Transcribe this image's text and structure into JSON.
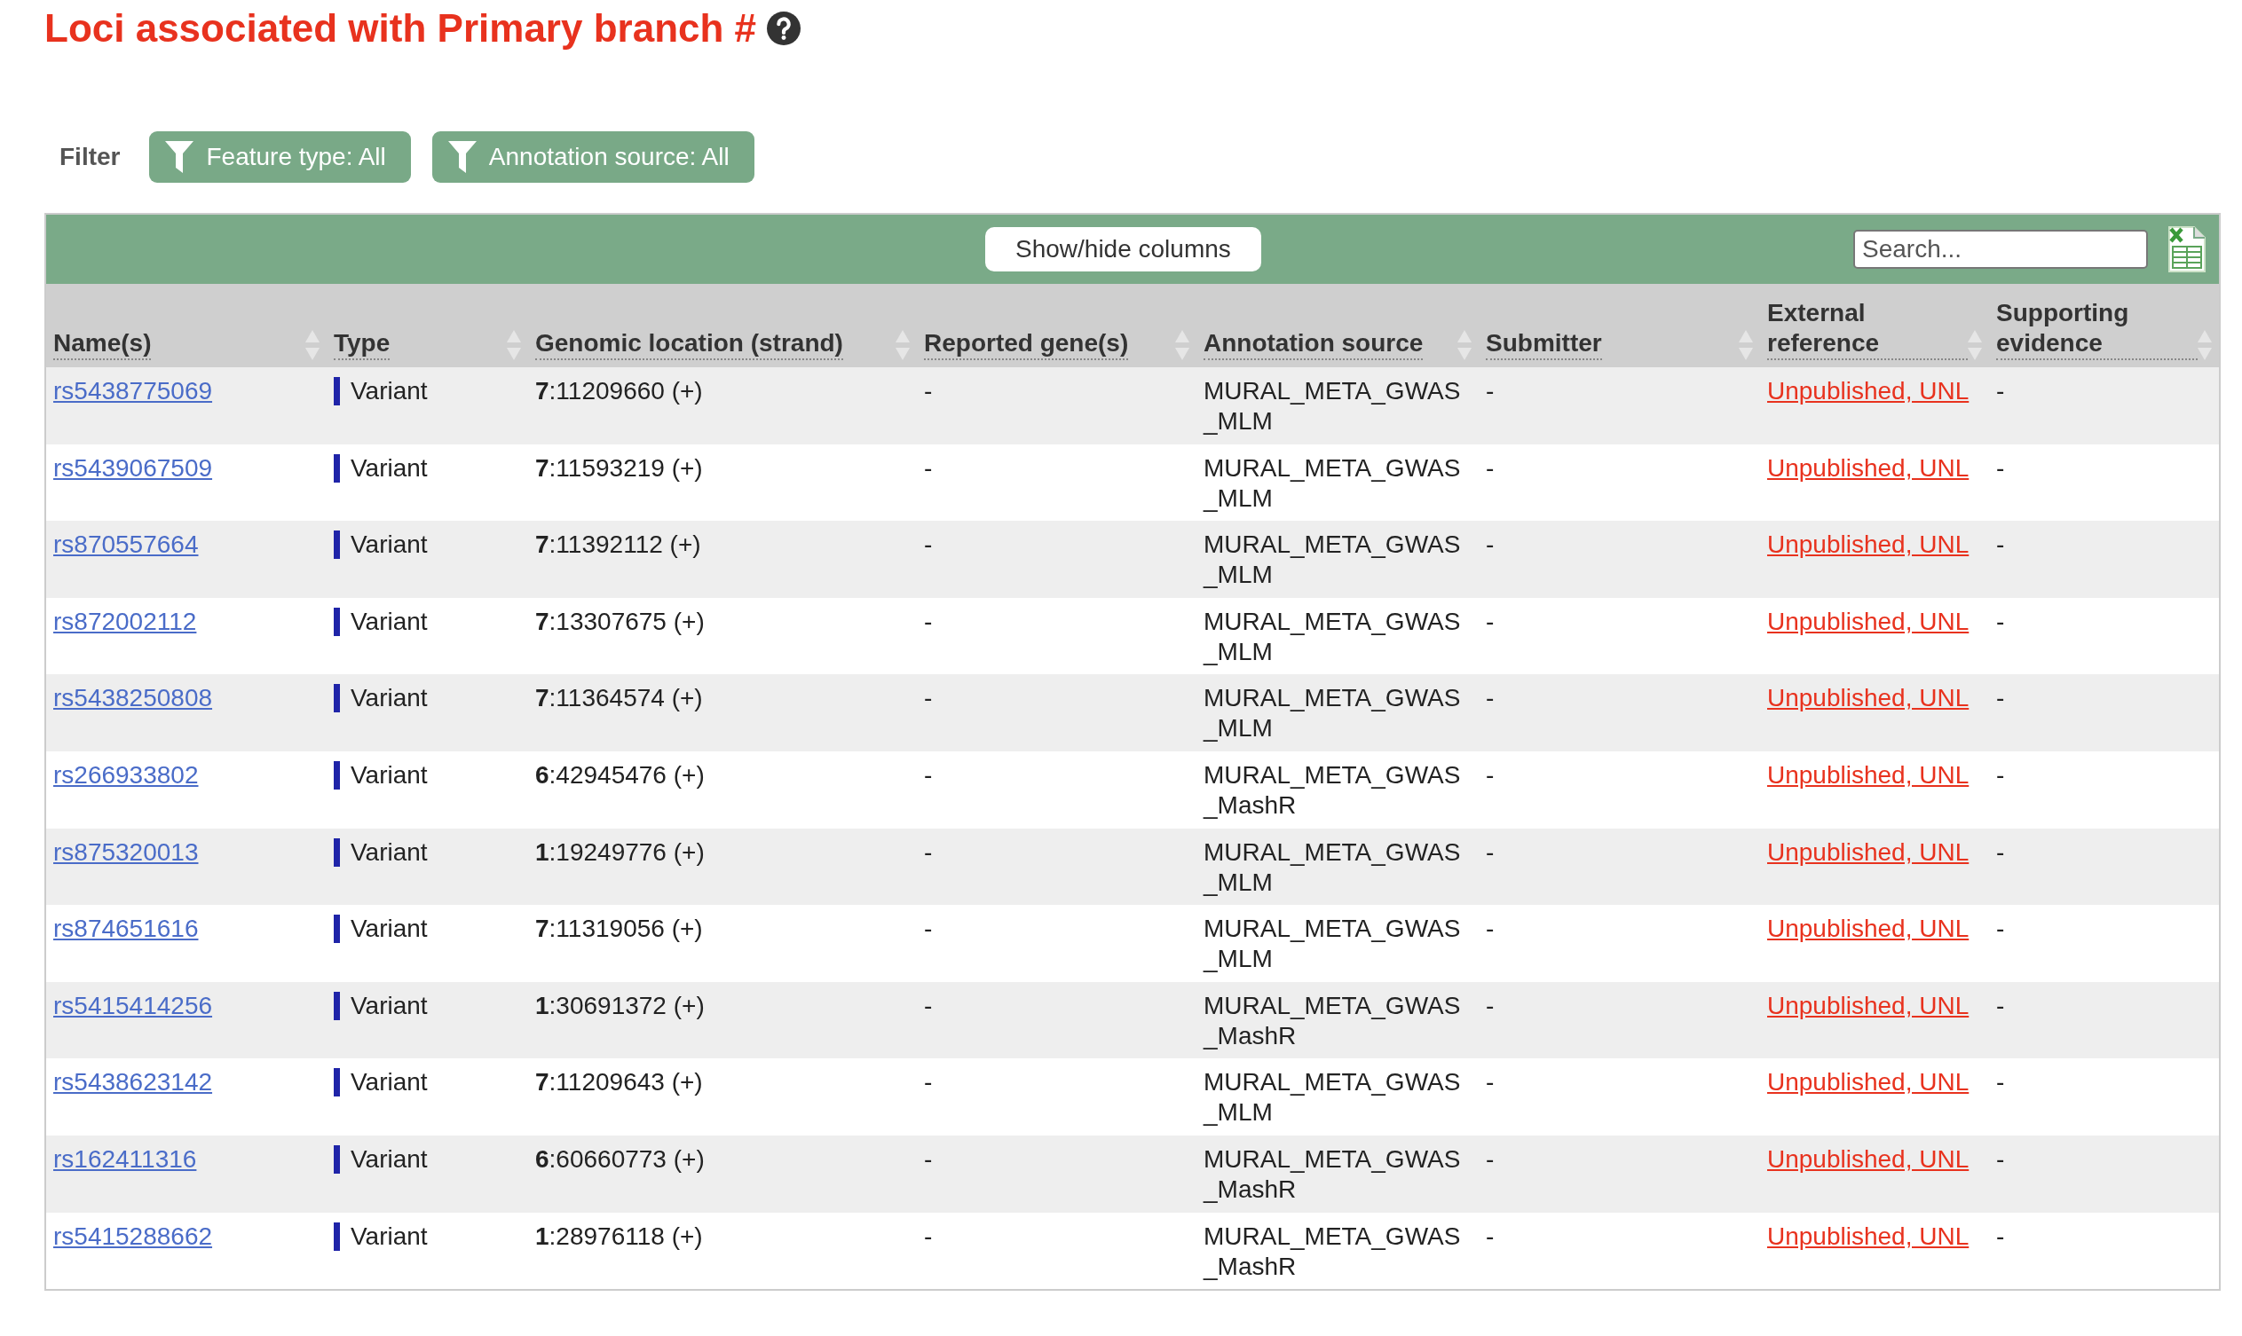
{
  "title": "Loci associated with Primary branch #",
  "filter": {
    "label": "Filter",
    "buttons": [
      "Feature type: All",
      "Annotation source: All"
    ]
  },
  "toolbar": {
    "columns_button": "Show/hide columns",
    "search": {
      "placeholder": "Search..."
    }
  },
  "table": {
    "columns": [
      "Name(s)",
      "Type",
      "Genomic location (strand)",
      "Reported gene(s)",
      "Annotation source",
      "Submitter",
      "External reference",
      "Supporting evidence"
    ],
    "rows": [
      {
        "name": "rs5438775069",
        "type": "Variant",
        "color": "#1f24a8",
        "location": "**7**:11209660 (+)",
        "genes": "-",
        "source": "MURAL_META_GWAS_MLM",
        "submitter": "-",
        "reference": "Unpublished, UNL",
        "evidence": "-"
      },
      {
        "name": "rs5439067509",
        "type": "Variant",
        "color": "#1f24a8",
        "location": "**7**:11593219 (+)",
        "genes": "-",
        "source": "MURAL_META_GWAS_MLM",
        "submitter": "-",
        "reference": "Unpublished, UNL",
        "evidence": "-"
      },
      {
        "name": "rs870557664",
        "type": "Variant",
        "color": "#1f24a8",
        "location": "**7**:11392112 (+)",
        "genes": "-",
        "source": "MURAL_META_GWAS_MLM",
        "submitter": "-",
        "reference": "Unpublished, UNL",
        "evidence": "-"
      },
      {
        "name": "rs872002112",
        "type": "Variant",
        "color": "#1f24a8",
        "location": "**7**:13307675 (+)",
        "genes": "-",
        "source": "MURAL_META_GWAS_MLM",
        "submitter": "-",
        "reference": "Unpublished, UNL",
        "evidence": "-"
      },
      {
        "name": "rs5438250808",
        "type": "Variant",
        "color": "#1f24a8",
        "location": "**7**:11364574 (+)",
        "genes": "-",
        "source": "MURAL_META_GWAS_MLM",
        "submitter": "-",
        "reference": "Unpublished, UNL",
        "evidence": "-"
      },
      {
        "name": "rs266933802",
        "type": "Variant",
        "color": "#1f24a8",
        "location": "**6**:42945476 (+)",
        "genes": "-",
        "source": "MURAL_META_GWAS_MashR",
        "submitter": "-",
        "reference": "Unpublished, UNL",
        "evidence": "-"
      },
      {
        "name": "rs875320013",
        "type": "Variant",
        "color": "#1f24a8",
        "location": "**1**:19249776 (+)",
        "genes": "-",
        "source": "MURAL_META_GWAS_MLM",
        "submitter": "-",
        "reference": "Unpublished, UNL",
        "evidence": "-"
      },
      {
        "name": "rs874651616",
        "type": "Variant",
        "color": "#1f24a8",
        "location": "**7**:11319056 (+)",
        "genes": "-",
        "source": "MURAL_META_GWAS_MLM",
        "submitter": "-",
        "reference": "Unpublished, UNL",
        "evidence": "-"
      },
      {
        "name": "rs5415414256",
        "type": "Variant",
        "color": "#1f24a8",
        "location": "**1**:30691372 (+)",
        "genes": "-",
        "source": "MURAL_META_GWAS_MashR",
        "submitter": "-",
        "reference": "Unpublished, UNL",
        "evidence": "-"
      },
      {
        "name": "rs5438623142",
        "type": "Variant",
        "color": "#1f24a8",
        "location": "**7**:11209643 (+)",
        "genes": "-",
        "source": "MURAL_META_GWAS_MLM",
        "submitter": "-",
        "reference": "Unpublished, UNL",
        "evidence": "-"
      },
      {
        "name": "rs162411316",
        "type": "Variant",
        "color": "#1f24a8",
        "location": "**6**:60660773 (+)",
        "genes": "-",
        "source": "MURAL_META_GWAS_MashR",
        "submitter": "-",
        "reference": "Unpublished, UNL",
        "evidence": "-"
      },
      {
        "name": "rs5415288662",
        "type": "Variant",
        "color": "#1f24a8",
        "location": "**1**:28976118 (+)",
        "genes": "-",
        "source": "MURAL_META_GWAS_MashR",
        "submitter": "-",
        "reference": "Unpublished, UNL",
        "evidence": "-"
      }
    ]
  }
}
